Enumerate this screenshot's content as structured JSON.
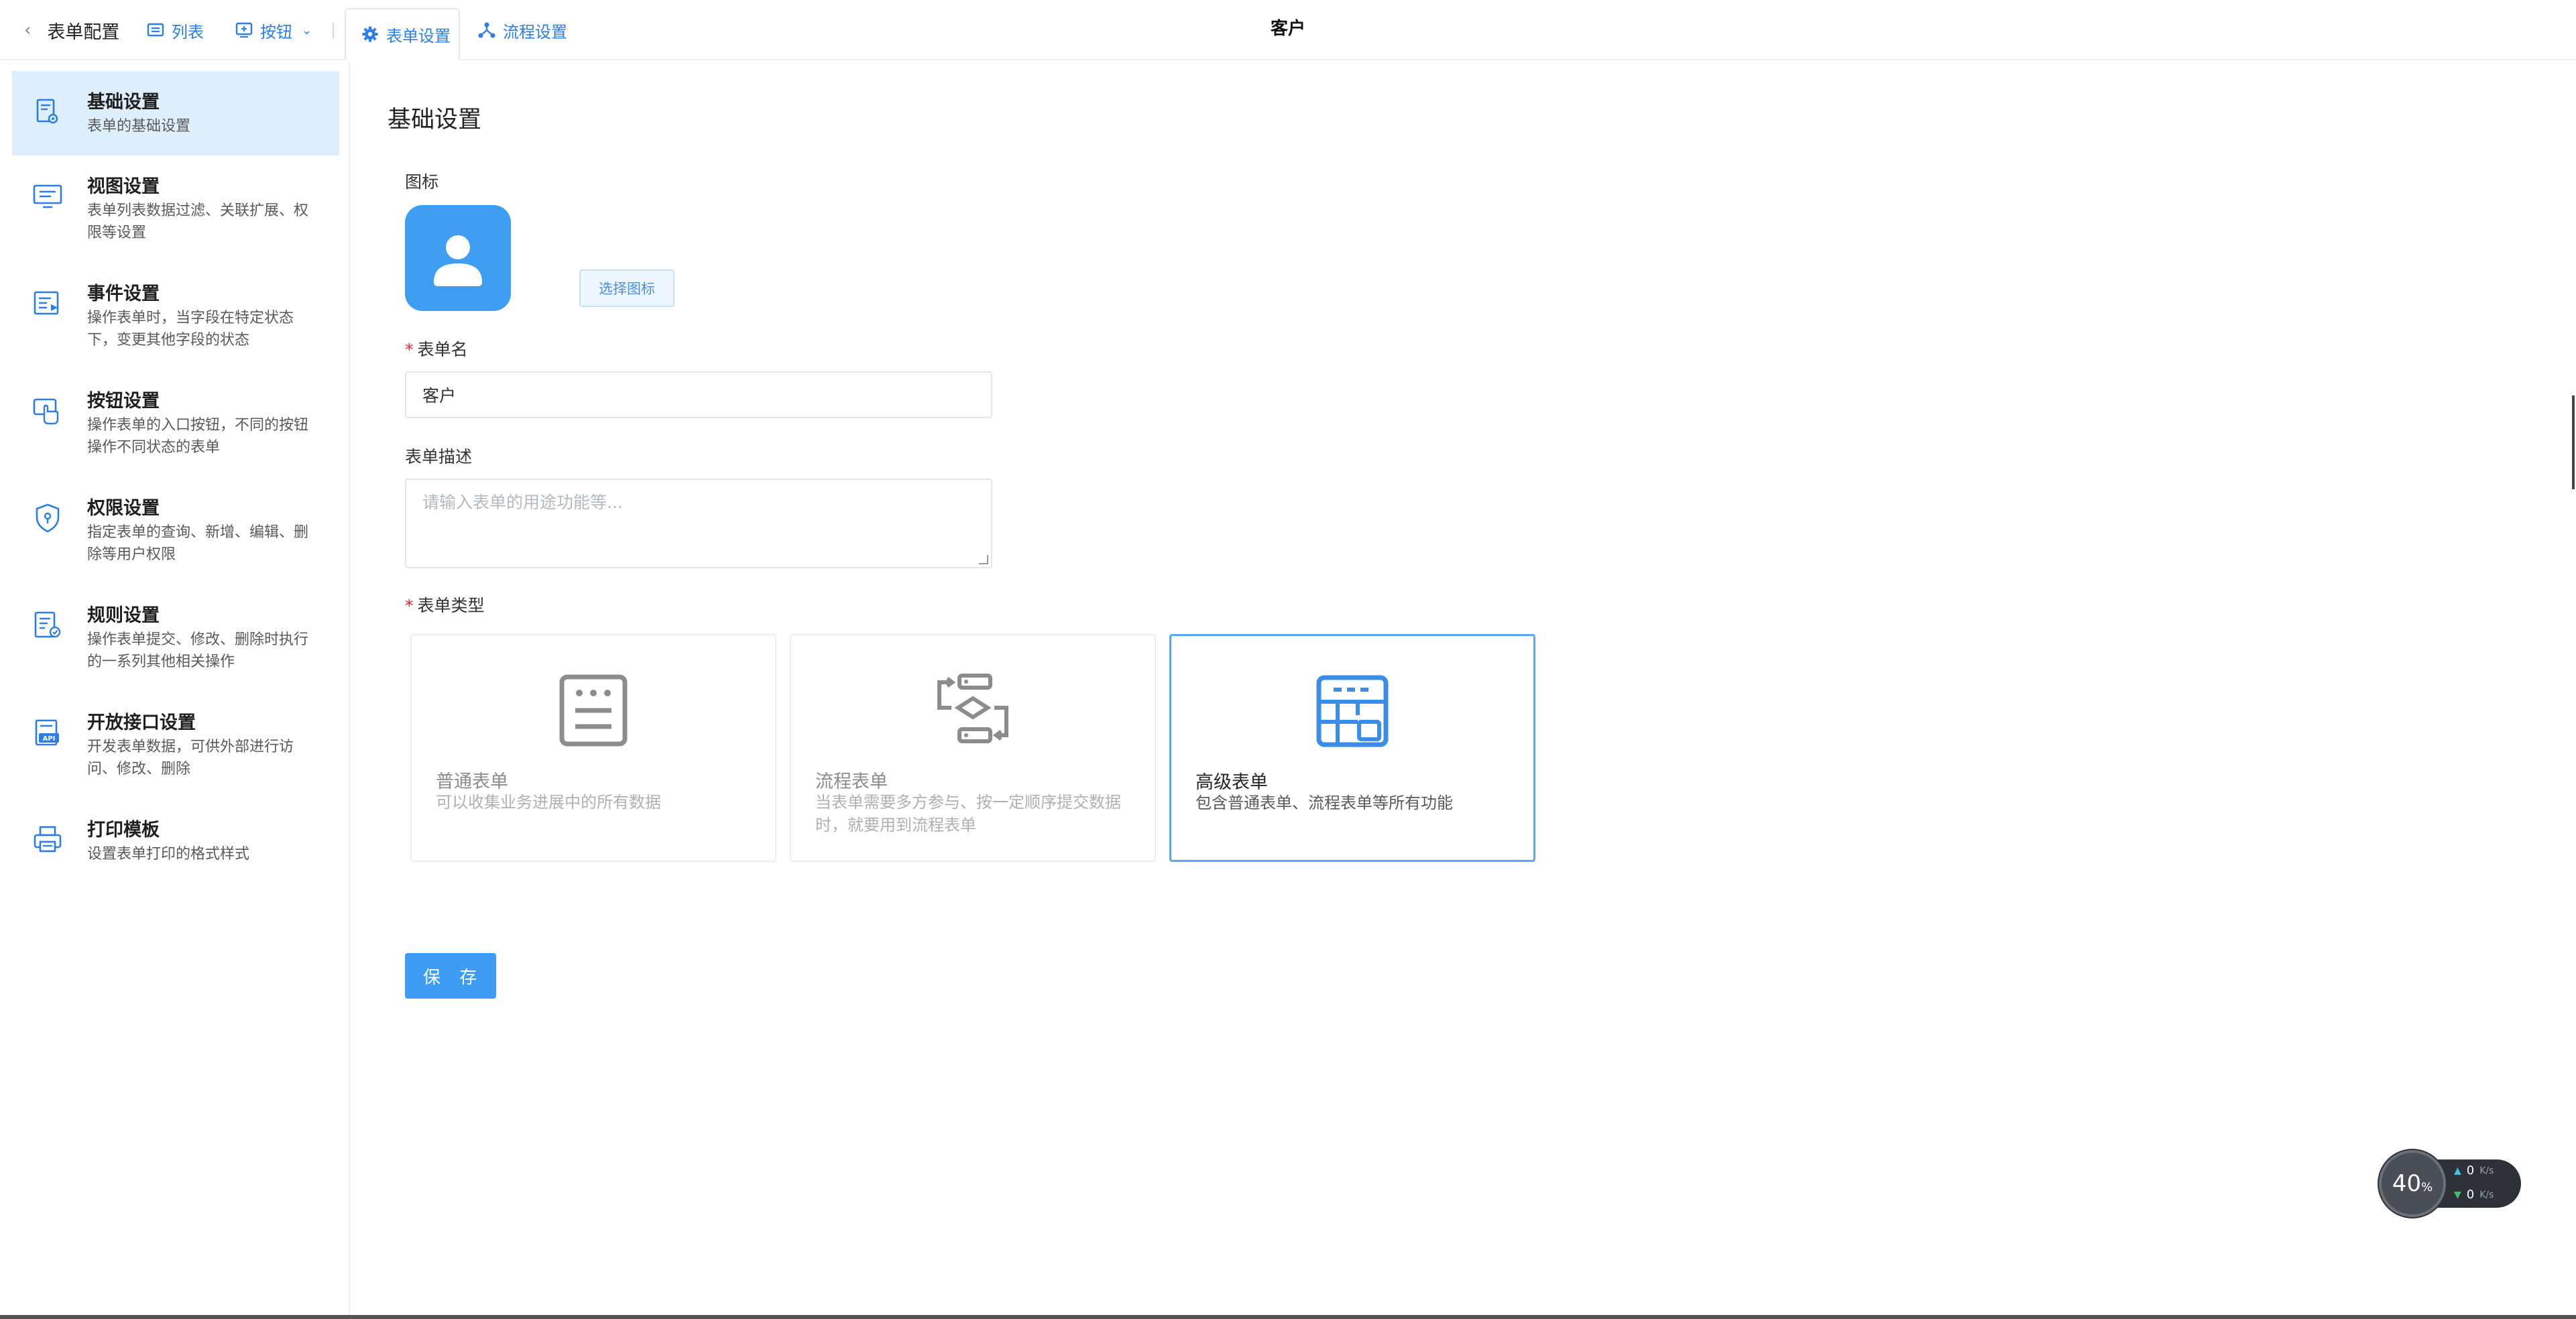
{
  "topbar": {
    "back_label": "表单配置",
    "list_label": "列表",
    "button_label": "按钮",
    "form_settings_label": "表单设置",
    "flow_settings_label": "流程设置",
    "page_title": "客户"
  },
  "sidebar": {
    "items": [
      {
        "title": "基础设置",
        "desc": "表单的基础设置"
      },
      {
        "title": "视图设置",
        "desc": "表单列表数据过滤、关联扩展、权限等设置"
      },
      {
        "title": "事件设置",
        "desc": "操作表单时，当字段在特定状态下，变更其他字段的状态"
      },
      {
        "title": "按钮设置",
        "desc": "操作表单的入口按钮，不同的按钮操作不同状态的表单"
      },
      {
        "title": "权限设置",
        "desc": "指定表单的查询、新增、编辑、删除等用户权限"
      },
      {
        "title": "规则设置",
        "desc": "操作表单提交、修改、删除时执行的一系列其他相关操作"
      },
      {
        "title": "开放接口设置",
        "desc": "开发表单数据，可供外部进行访问、修改、删除"
      },
      {
        "title": "打印模板",
        "desc": "设置表单打印的格式样式"
      }
    ],
    "active_index": 0,
    "icons": [
      "form-gear-icon",
      "monitor-icon",
      "event-icon",
      "hand-pointer-icon",
      "shield-icon",
      "rule-doc-icon",
      "api-icon",
      "printer-icon"
    ]
  },
  "main": {
    "section_title": "基础设置",
    "icon_label": "图标",
    "choose_icon_label": "选择图标",
    "form_name_label": "表单名",
    "form_name_value": "客户",
    "form_desc_label": "表单描述",
    "form_desc_placeholder": "请输入表单的用途功能等...",
    "form_type_label": "表单类型",
    "form_types": [
      {
        "title": "普通表单",
        "desc": "可以收集业务进展中的所有数据"
      },
      {
        "title": "流程表单",
        "desc": "当表单需要多方参与、按一定顺序提交数据时，就要用到流程表单"
      },
      {
        "title": "高级表单",
        "desc": "包含普通表单、流程表单等所有功能"
      }
    ],
    "selected_type_index": 2,
    "save_label": "保 存"
  },
  "speed_widget": {
    "percent": "40",
    "percent_unit": "%",
    "upload": "0",
    "download": "0",
    "unit": "K/s"
  },
  "colors": {
    "accent": "#2b7de9",
    "primary_button": "#3f9cf4",
    "active_bg": "#ddeefd",
    "required": "#f5222d"
  }
}
